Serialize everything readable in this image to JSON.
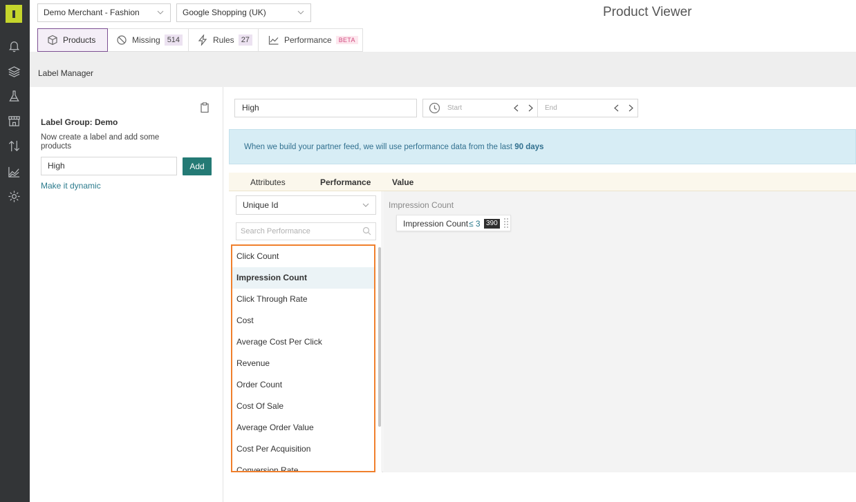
{
  "topbar": {
    "merchant_select": "Demo Merchant - Fashion",
    "channel_select": "Google Shopping (UK)",
    "page_title": "Product Viewer"
  },
  "sidebar": {
    "icons": [
      "bell-icon",
      "layers-icon",
      "flask-icon",
      "store-icon",
      "sort-arrows-icon",
      "chart-icon",
      "gear-icon"
    ]
  },
  "tabs": [
    {
      "label": "Products",
      "icon": "box-icon"
    },
    {
      "label": "Missing",
      "badge": "514",
      "icon": "block-icon"
    },
    {
      "label": "Rules",
      "badge": "27",
      "icon": "bolt-icon"
    },
    {
      "label": "Performance",
      "tag": "BETA",
      "icon": "line-chart-icon"
    }
  ],
  "subheader": {
    "title": "Label Manager"
  },
  "label_group": {
    "title": "Label Group: Demo",
    "hint": "Now create a label and add some products",
    "input_value": "High",
    "add_label": "Add",
    "dynamic_link": "Make it dynamic"
  },
  "filter": {
    "value": "High",
    "start_placeholder": "Start",
    "end_placeholder": "End"
  },
  "info": {
    "text": "When we build your partner feed, we will use performance data from the last ",
    "bold": "90 days",
    "bg_color": "#d7edf5"
  },
  "rule_tabs": {
    "attributes": "Attributes",
    "performance": "Performance",
    "value": "Value"
  },
  "attribute_select": "Unique Id",
  "search_placeholder": "Search Performance",
  "metrics": [
    "Click Count",
    "Impression Count",
    "Click Through Rate",
    "Cost",
    "Average Cost Per Click",
    "Revenue",
    "Order Count",
    "Cost Of Sale",
    "Average Order Value",
    "Cost Per Acquisition",
    "Conversion Rate"
  ],
  "selected_metric": "Impression Count",
  "condition": {
    "title": "Impression Count",
    "name": "Impression Count",
    "operator": "≤ 3",
    "value": "390"
  },
  "colors": {
    "accent": "#247a75",
    "highlight": "#f07f2c",
    "sidebar": "#333537",
    "logo": "#c5d52c"
  }
}
